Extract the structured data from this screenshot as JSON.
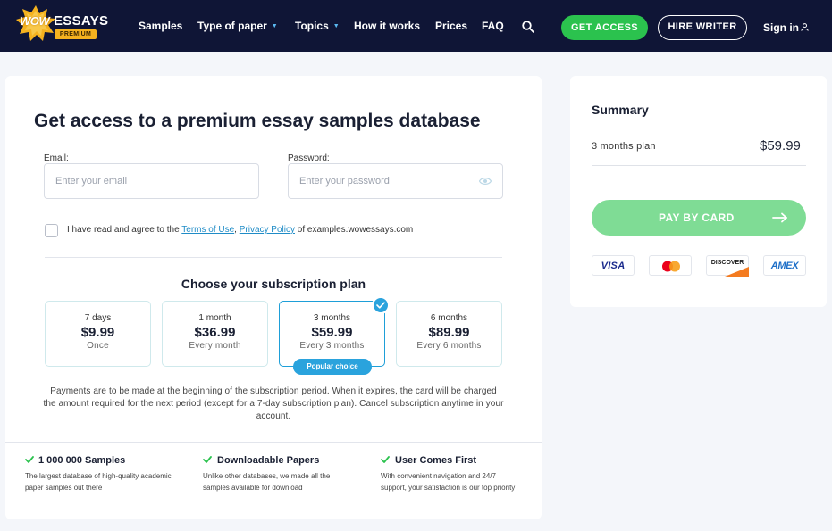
{
  "header": {
    "logo": {
      "wow": "WOW",
      "essays": "ESSAYS",
      "premium": "PREMIUM"
    },
    "nav": [
      {
        "label": "Samples",
        "dropdown": false
      },
      {
        "label": "Type of paper",
        "dropdown": true
      },
      {
        "label": "Topics",
        "dropdown": true
      },
      {
        "label": "How it works",
        "dropdown": false
      },
      {
        "label": "Prices",
        "dropdown": false
      },
      {
        "label": "FAQ",
        "dropdown": false
      }
    ],
    "get_access": "GET ACCESS",
    "hire_writer": "HIRE WRITER",
    "sign_in": "Sign in"
  },
  "form": {
    "title": "Get access to a premium essay samples database",
    "email_label": "Email:",
    "email_placeholder": "Enter your email",
    "password_label": "Password:",
    "password_placeholder": "Enter your password",
    "agree_prefix": "I have read and agree to the",
    "terms_link": "Terms of Use",
    "agree_sep": ",",
    "privacy_link": "Privacy Policy",
    "agree_suffix": "of examples.wowessays.com"
  },
  "plans": {
    "title": "Choose your subscription plan",
    "items": [
      {
        "duration": "7 days",
        "price": "$9.99",
        "period": "Once",
        "selected": false
      },
      {
        "duration": "1 month",
        "price": "$36.99",
        "period": "Every month",
        "selected": false
      },
      {
        "duration": "3 months",
        "price": "$59.99",
        "period": "Every 3 months",
        "selected": true
      },
      {
        "duration": "6 months",
        "price": "$89.99",
        "period": "Every 6 months",
        "selected": false
      }
    ],
    "popular_badge": "Popular choice",
    "payment_info": "Payments are to be made at the beginning of the subscription period. When it expires, the card will be charged the amount required for the next period (except for a 7-day subscription plan). Cancel subscription anytime in your account."
  },
  "features": [
    {
      "title": "1 000 000 Samples",
      "desc": "The largest database of high-quality academic paper samples out there"
    },
    {
      "title": "Downloadable Papers",
      "desc": "Unlike other databases, we made all the samples available for download"
    },
    {
      "title": "User Comes First",
      "desc": "With convenient navigation and 24/7 support, your satisfaction is our top priority"
    }
  ],
  "summary": {
    "title": "Summary",
    "plan": "3 months plan",
    "price": "$59.99",
    "pay_button": "PAY BY CARD",
    "cards": {
      "visa": "VISA",
      "discover": "DISCOVER",
      "amex": "AMEX"
    }
  },
  "colors": {
    "header_bg": "#0f1536",
    "accent_green": "#2bc24e",
    "pay_green": "#7fdc95",
    "accent_blue": "#2aa3dd",
    "link_blue": "#1f8cc7"
  }
}
